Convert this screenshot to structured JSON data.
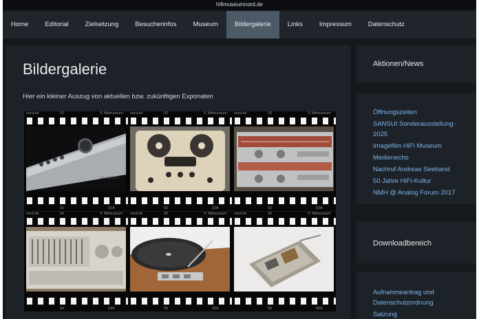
{
  "browser": {
    "url": "hifimuseumnord.de"
  },
  "nav": {
    "items": [
      "Home",
      "Editorial",
      "Zielsetzung",
      "Besucherinfos",
      "Museum",
      "Bildergalerie",
      "Links",
      "Impressum",
      "Datenschutz"
    ],
    "active": "Bildergalerie"
  },
  "main": {
    "title": "Bildergalerie",
    "intro": "Hier ein kleiner Auszug von aktuellen bzw. zukünftigen Exponaten"
  },
  "gallery": {
    "frames": [
      {
        "site": "nord.de",
        "num": "01",
        "brand": "© hifimuseum",
        "bottom_num": "01",
        "bottom_code": "01A",
        "image": "amplifier-photo"
      },
      {
        "site": "nord.de",
        "num": "02",
        "brand": "© hifimuseum",
        "bottom_num": "02",
        "bottom_code": "02A",
        "image": "tape-recorder-photo"
      },
      {
        "site": "nord.de",
        "num": "03",
        "brand": "© hifimuseum",
        "bottom_num": "03",
        "bottom_code": "03A",
        "image": "receiver-photo"
      },
      {
        "site": "nord.de",
        "num": "04",
        "brand": "© hifimuseum",
        "bottom_num": "04",
        "bottom_code": "04A",
        "image": "equalizer-photo"
      },
      {
        "site": "nord.de",
        "num": "05",
        "brand": "© hifimuseum",
        "bottom_num": "05",
        "bottom_code": "05A",
        "image": "turntable-photo"
      },
      {
        "site": "nord.de",
        "num": "06",
        "brand": "© hifimuseum",
        "bottom_num": "06",
        "bottom_code": "06A",
        "image": "tonearm-cartridge-photo"
      }
    ]
  },
  "sidebar": {
    "news_title": "Aktionen/News",
    "news_links": [
      "Öffnungszeiten",
      "SANSUI Sonderausstellung-2025",
      "Imagefilm HiFi Museum",
      "Medienecho",
      "Nachruf Andreas Seeband",
      "50 Jahre HiFi-Kultur",
      "NMH @ Analog Forum 2017"
    ],
    "download_title": "Downloadbereich",
    "download_links": [
      "Aufnahmeantrag und Datenschutzordnung",
      "Satzung"
    ]
  }
}
